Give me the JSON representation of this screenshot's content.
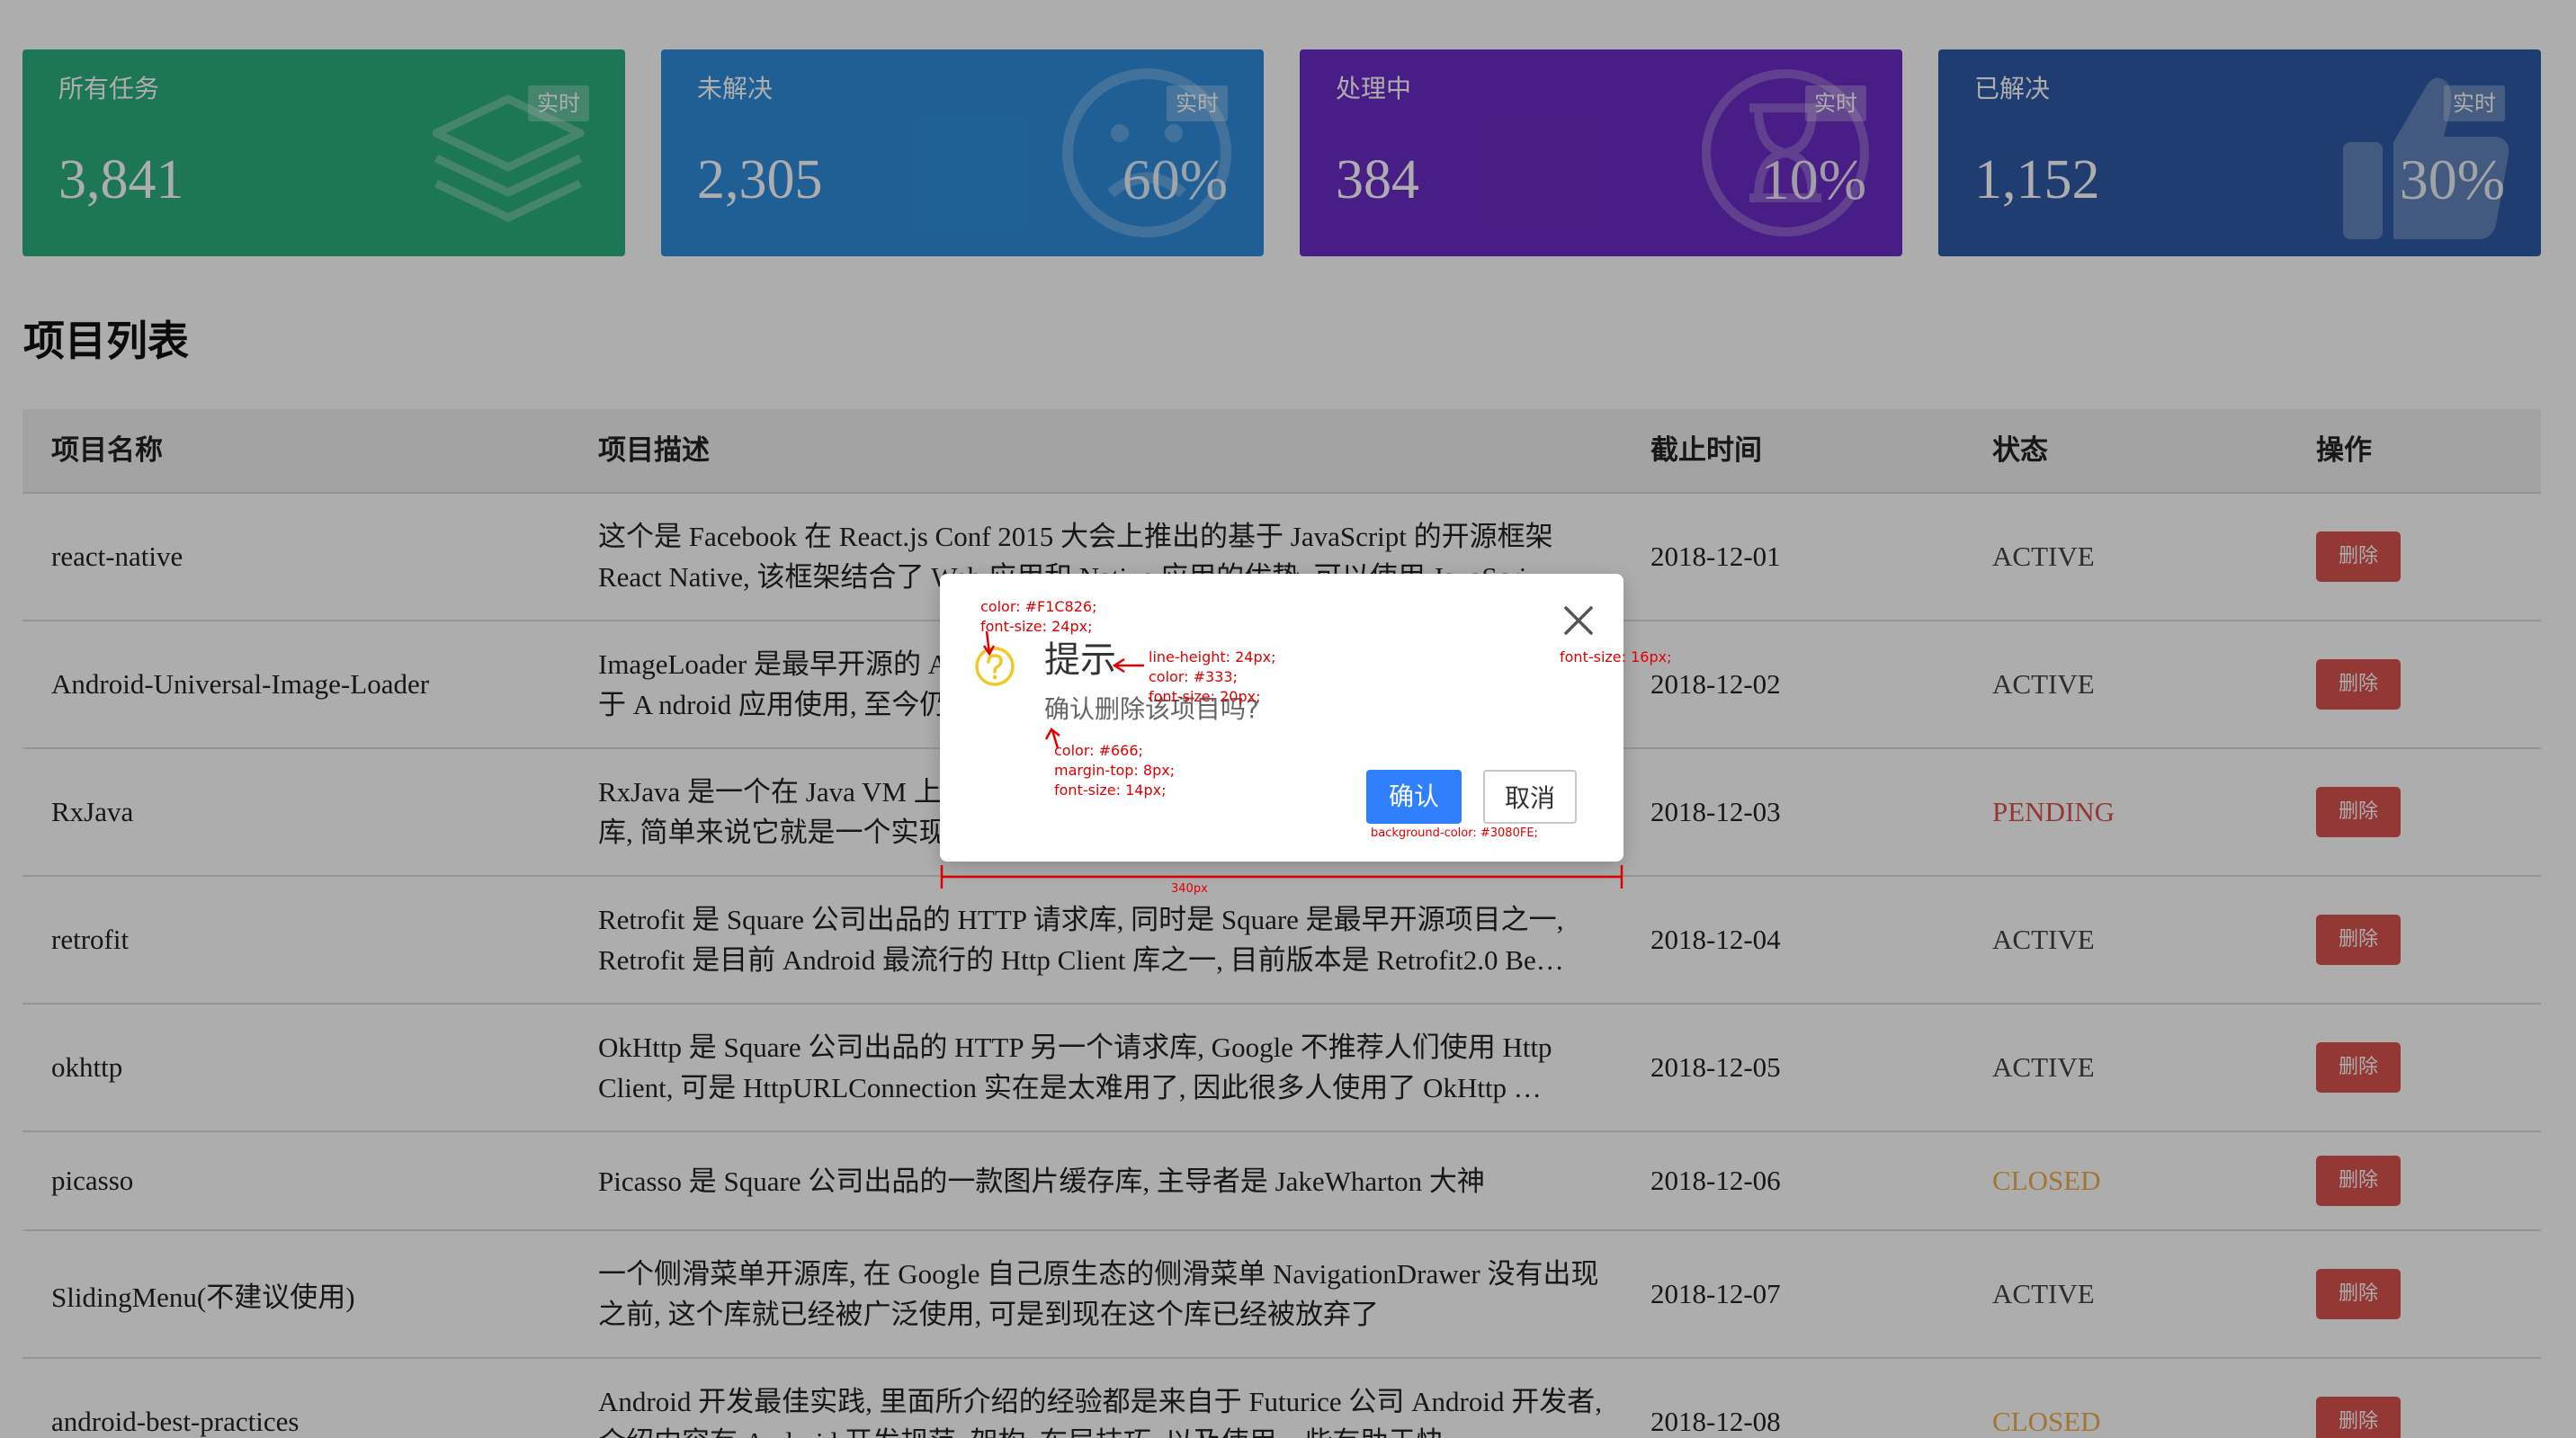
{
  "colors": {
    "card_green": "#2BAE7E",
    "card_blue": "#2E8DDE",
    "card_purple": "#6A2CC4",
    "card_navy": "#2F5AA6",
    "delete_red": "#D9534F",
    "pending_red": "#D9534F",
    "closed_yellow": "#F0AD4E",
    "confirm_blue": "#3080FE",
    "question_icon": "#F1C826",
    "annotation_red": "#E00000"
  },
  "cards": [
    {
      "title": "所有任务",
      "value": "3,841",
      "badge": "实时",
      "percent": "",
      "icon": "layers-icon"
    },
    {
      "title": "未解决",
      "value": "2,305",
      "badge": "实时",
      "percent": "60%",
      "icon": "sad-face-icon"
    },
    {
      "title": "处理中",
      "value": "384",
      "badge": "实时",
      "percent": "10%",
      "icon": "hourglass-icon"
    },
    {
      "title": "已解决",
      "value": "1,152",
      "badge": "实时",
      "percent": "30%",
      "icon": "thumbs-up-icon"
    }
  ],
  "section_title": "项目列表",
  "table": {
    "headers": [
      "项目名称",
      "项目描述",
      "截止时间",
      "状态",
      "操作"
    ],
    "rows": [
      {
        "name": "react-native",
        "desc": "这个是 Facebook 在 React.js Conf 2015 大会上推出的基于 JavaScript 的开源框架 React Native, 该框架结合了 Web 应用和 Native 应用的优势, 可以使用 JavaScri…",
        "deadline": "2018-12-01",
        "status": "ACTIVE",
        "status_class": "active",
        "action": "删除"
      },
      {
        "name": "Android-Universal-Image-Loader",
        "desc": "ImageLoader 是最早开源的 Android 图片缓存库, 强大的缓存机制, 早期被广泛应用于 A ndroid 应用使用, 至今仍然有很多 Android 开发者…",
        "deadline": "2018-12-02",
        "status": "ACTIVE",
        "status_class": "active",
        "action": "删除"
      },
      {
        "name": "RxJava",
        "desc": "RxJava 是一个在 Java VM 上使用可观测的序列来组成异步的、基于事件的程序的库, 简单来说它就是一个实现异步操作的库…",
        "deadline": "2018-12-03",
        "status": "PENDING",
        "status_class": "pending",
        "action": "删除"
      },
      {
        "name": "retrofit",
        "desc": "Retrofit 是 Square 公司出品的 HTTP 请求库, 同时是 Square 是最早开源项目之一, Retrofit 是目前 Android 最流行的 Http Client 库之一, 目前版本是 Retrofit2.0 Be…",
        "deadline": "2018-12-04",
        "status": "ACTIVE",
        "status_class": "active",
        "action": "删除"
      },
      {
        "name": "okhttp",
        "desc": "OkHttp 是 Square 公司出品的 HTTP 另一个请求库, Google 不推荐人们使用 Http Client, 可是 HttpURLConnection 实在是太难用了, 因此很多人使用了 OkHttp …",
        "deadline": "2018-12-05",
        "status": "ACTIVE",
        "status_class": "active",
        "action": "删除"
      },
      {
        "name": "picasso",
        "desc": "Picasso 是 Square 公司出品的一款图片缓存库, 主导者是 JakeWharton 大神",
        "deadline": "2018-12-06",
        "status": "CLOSED",
        "status_class": "closed",
        "action": "删除"
      },
      {
        "name": "SlidingMenu(不建议使用)",
        "desc": "一个侧滑菜单开源库, 在 Google 自己原生态的侧滑菜单 NavigationDrawer 没有出现之前, 这个库就已经被广泛使用, 可是到现在这个库已经被放弃了",
        "deadline": "2018-12-07",
        "status": "ACTIVE",
        "status_class": "active",
        "action": "删除"
      },
      {
        "name": "android-best-practices",
        "desc": "Android 开发最佳实践, 里面所介绍的经验都是来自于 Futurice 公司 Android 开发者, 介绍内容有 Android 开发规范, 架构, 布局技巧, 以及使用一些有助于快…",
        "deadline": "2018-12-08",
        "status": "CLOSED",
        "status_class": "closed",
        "action": "删除"
      }
    ]
  },
  "modal": {
    "title": "提示",
    "message": "确认删除该项目吗?",
    "confirm_label": "确认",
    "cancel_label": "取消",
    "close_icon": "close-icon",
    "question_icon": "question-circle-icon"
  },
  "annotations": {
    "icon_spec": "color: #F1C826;\nfont-size: 24px;",
    "title_spec": "line-height: 24px;\ncolor: #333;\nfont-size: 20px;",
    "message_spec": "color: #666;\nmargin-top: 8px;\nfont-size: 14px;",
    "close_spec": "font-size: 16px;",
    "confirm_spec": "background-color: #3080FE;",
    "width_spec": "340px"
  }
}
